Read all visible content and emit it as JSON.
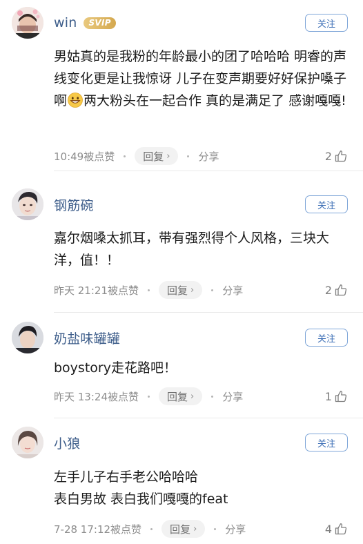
{
  "follow_label": "关注",
  "reply_label": "回复",
  "share_label": "分享",
  "comments": [
    {
      "username": "win",
      "badge": "SVIP",
      "text_before_emoji": "男姑真的是我粉的年龄最小的团了哈哈哈 明睿的声线变化更是让我惊讶 儿子在变声期要好好保护嗓子啊",
      "emoji": "grinning-face-emoji",
      "text_after_emoji": "两大粉头在一起合作 真的是满足了 感谢嘎嘎!",
      "time": "10:49被点赞",
      "likes": "2"
    },
    {
      "username": "钢筋碗",
      "lines": [
        "嘉尔烟嗓太抓耳，带有强烈得个人风格，三块大洋，值！！"
      ],
      "time": "昨天 21:21被点赞",
      "likes": "2"
    },
    {
      "username": "奶盐味罐罐",
      "lines": [
        "boystory走花路吧！"
      ],
      "time": "昨天 13:24被点赞",
      "likes": "1"
    },
    {
      "username": "小狼",
      "lines": [
        "左手儿子右手老公哈哈哈",
        "表白男故 表白我们嘎嘎的feat"
      ],
      "time": "7-28 17:12被点赞",
      "likes": "4"
    }
  ]
}
